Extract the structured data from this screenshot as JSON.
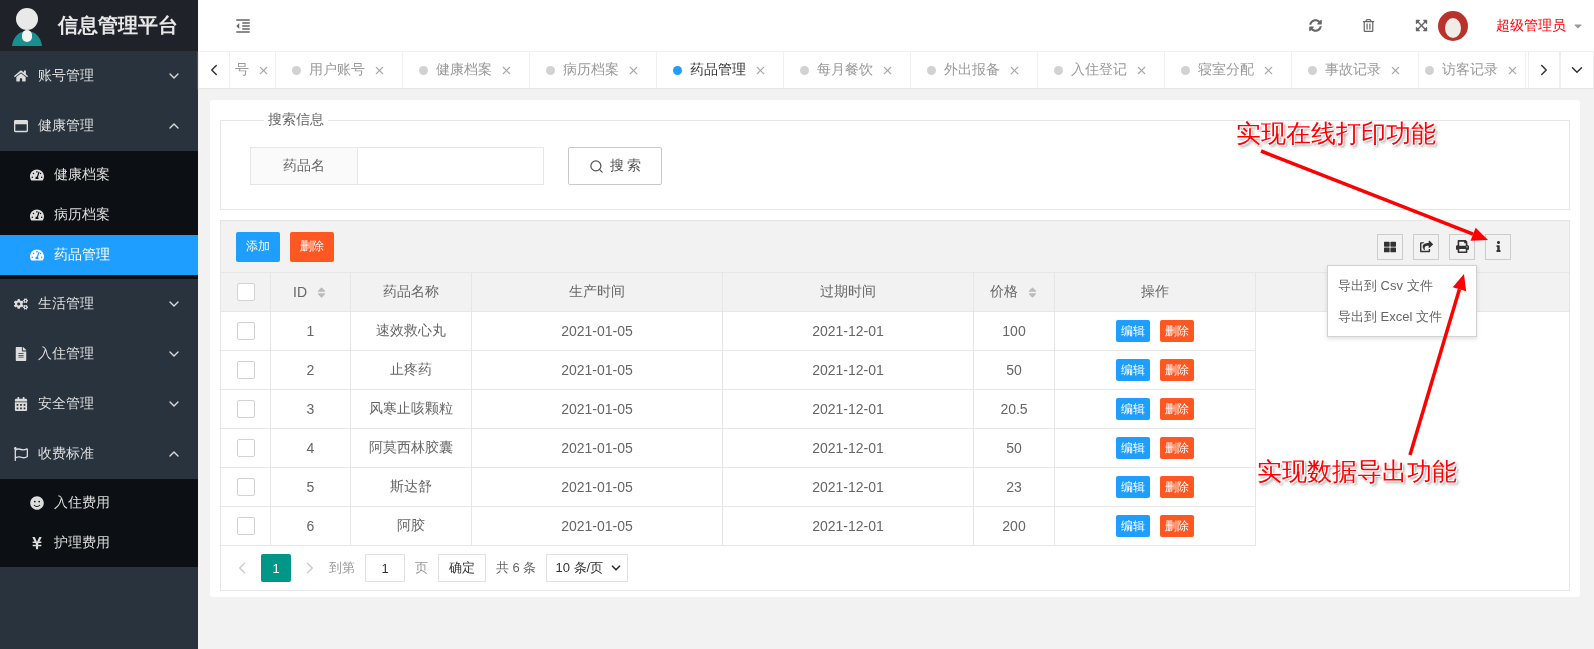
{
  "app": {
    "title": "信息管理平台"
  },
  "header": {
    "user": "超级管理员"
  },
  "sidebar": {
    "items": [
      {
        "label": "账号管理",
        "expanded": false
      },
      {
        "label": "健康管理",
        "expanded": true,
        "children": [
          {
            "label": "健康档案",
            "selected": false
          },
          {
            "label": "病历档案",
            "selected": false
          },
          {
            "label": "药品管理",
            "selected": true
          }
        ]
      },
      {
        "label": "生活管理",
        "expanded": false
      },
      {
        "label": "入住管理",
        "expanded": false
      },
      {
        "label": "安全管理",
        "expanded": false
      },
      {
        "label": "收费标准",
        "expanded": true,
        "children": [
          {
            "label": "入住费用",
            "selected": false
          },
          {
            "label": "护理费用",
            "selected": false
          }
        ]
      }
    ]
  },
  "tabs": [
    {
      "label": "号",
      "selected": false
    },
    {
      "label": "用户账号",
      "selected": false
    },
    {
      "label": "健康档案",
      "selected": false
    },
    {
      "label": "病历档案",
      "selected": false
    },
    {
      "label": "药品管理",
      "selected": true
    },
    {
      "label": "每月餐饮",
      "selected": false
    },
    {
      "label": "外出报备",
      "selected": false
    },
    {
      "label": "入住登记",
      "selected": false
    },
    {
      "label": "寝室分配",
      "selected": false
    },
    {
      "label": "事故记录",
      "selected": false
    },
    {
      "label": "访客记录",
      "selected": false
    }
  ],
  "search": {
    "legend": "搜索信息",
    "label": "药品名",
    "button": "搜 索"
  },
  "toolbar": {
    "buttons": [
      {
        "label": "添加",
        "kind": "primary"
      },
      {
        "label": "删除",
        "kind": "danger"
      }
    ]
  },
  "export_menu": [
    "导出到 Csv 文件",
    "导出到 Excel 文件"
  ],
  "table": {
    "all_checked": false,
    "columns": [
      {
        "label": "ID",
        "sortable": true
      },
      {
        "label": "药品名称",
        "sortable": false
      },
      {
        "label": "生产时间",
        "sortable": false
      },
      {
        "label": "过期时间",
        "sortable": false
      },
      {
        "label": "价格",
        "sortable": true
      },
      {
        "label": "操作",
        "sortable": false
      }
    ],
    "rows": [
      {
        "checked": false,
        "cells": [
          "1",
          "速效救心丸",
          "2021-01-05",
          "2021-12-01",
          "100"
        ],
        "actions": [
          "编辑",
          "删除"
        ]
      },
      {
        "checked": false,
        "cells": [
          "2",
          "止疼药",
          "2021-01-05",
          "2021-12-01",
          "50"
        ],
        "actions": [
          "编辑",
          "删除"
        ]
      },
      {
        "checked": false,
        "cells": [
          "3",
          "风寒止咳颗粒",
          "2021-01-05",
          "2021-12-01",
          "20.5"
        ],
        "actions": [
          "编辑",
          "删除"
        ]
      },
      {
        "checked": false,
        "cells": [
          "4",
          "阿莫西林胶囊",
          "2021-01-05",
          "2021-12-01",
          "50"
        ],
        "actions": [
          "编辑",
          "删除"
        ]
      },
      {
        "checked": false,
        "cells": [
          "5",
          "斯达舒",
          "2021-01-05",
          "2021-12-01",
          "23"
        ],
        "actions": [
          "编辑",
          "删除"
        ]
      },
      {
        "checked": false,
        "cells": [
          "6",
          "阿胶",
          "2021-01-05",
          "2021-12-01",
          "200"
        ],
        "actions": [
          "编辑",
          "删除"
        ]
      }
    ]
  },
  "pagination": {
    "pages": [
      {
        "label": "1",
        "selected": true
      }
    ],
    "goto_label": "到第",
    "goto_value": "1",
    "page_unit": "页",
    "confirm": "确定",
    "total": "共 6 条",
    "page_size": "10 条/页"
  },
  "annotations": [
    {
      "text": "实现在线打印功能"
    },
    {
      "text": "实现数据导出功能"
    }
  ]
}
